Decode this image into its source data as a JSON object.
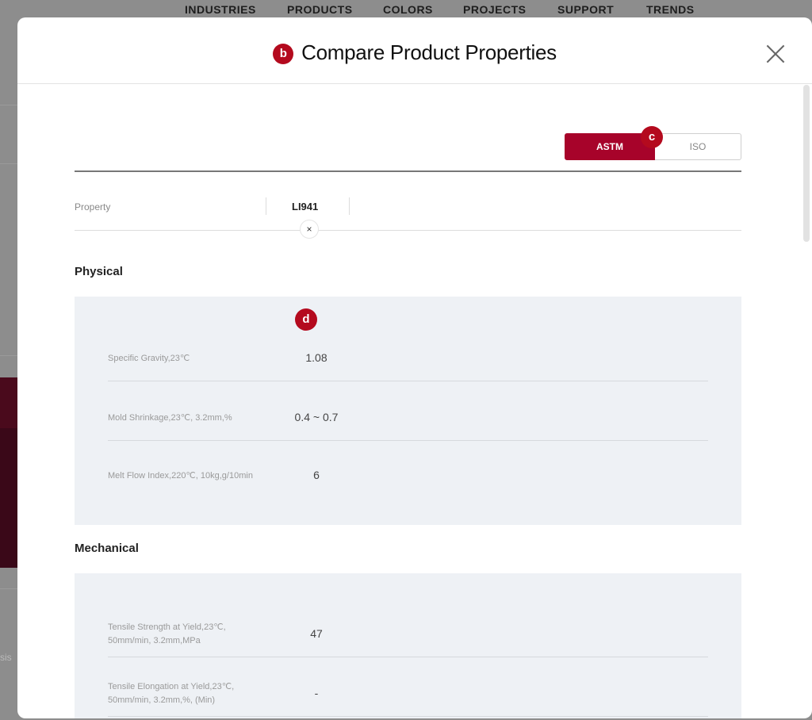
{
  "background_nav": [
    "INDUSTRIES",
    "PRODUCTS",
    "COLORS",
    "PROJECTS",
    "SUPPORT",
    "TRENDS"
  ],
  "background_fragment": "sis",
  "modal": {
    "title": "Compare Product Properties",
    "title_badge": "b"
  },
  "unit_toggle": {
    "badge": "c",
    "options": [
      "ASTM",
      "ISO"
    ],
    "selected": "ASTM"
  },
  "table_header": {
    "property_label": "Property",
    "product": "LI941",
    "remove_symbol": "×"
  },
  "sections": [
    {
      "title": "Physical",
      "badge": "d",
      "rows": [
        {
          "label": "Specific Gravity,23℃",
          "value": "1.08"
        },
        {
          "label": "Mold Shrinkage,23℃, 3.2mm,%",
          "value": "0.4 ~ 0.7"
        },
        {
          "label": "Melt Flow Index,220℃, 10kg,g/10min",
          "value": "6"
        }
      ]
    },
    {
      "title": "Mechanical",
      "rows": [
        {
          "label": "Tensile Strength at Yield,23℃, 50mm/min, 3.2mm,MPa",
          "value": "47"
        },
        {
          "label": "Tensile Elongation at Yield,23℃, 50mm/min, 3.2mm,%, (Min)",
          "value": "-"
        }
      ]
    }
  ],
  "colors": {
    "accent": "#a7032a",
    "badge": "#b40a1e",
    "panel_bg": "#eef1f5"
  }
}
